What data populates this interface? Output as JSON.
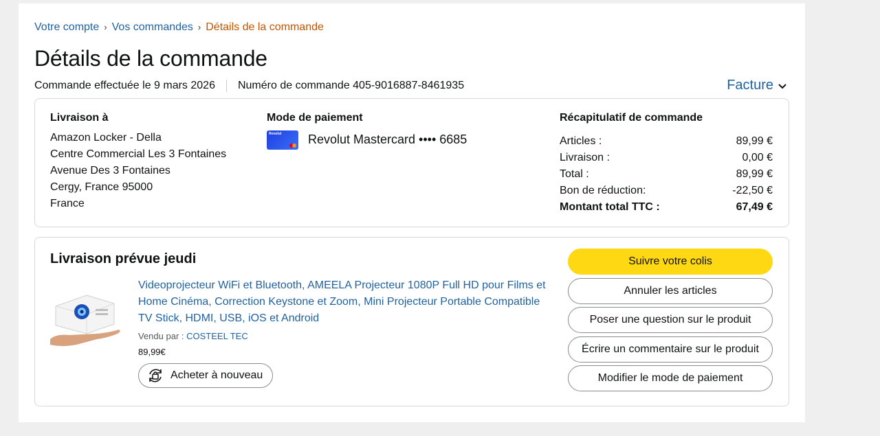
{
  "breadcrumb": {
    "item1": "Votre compte",
    "item2": "Vos commandes",
    "current": "Détails de la commande",
    "separator": "›"
  },
  "page_title": "Détails de la commande",
  "order_meta": {
    "placed": "Commande effectuée le 9 mars 2026",
    "number": "Numéro de commande 405-9016887-8461935"
  },
  "invoice_label": "Facture",
  "shipping": {
    "heading": "Livraison à",
    "lines": [
      "Amazon Locker - Della",
      "Centre Commercial Les 3 Fontaines",
      "Avenue Des 3 Fontaines",
      "Cergy, France 95000",
      "France"
    ]
  },
  "payment": {
    "heading": "Mode de paiement",
    "card_brand": "Revolut",
    "card_text": "Revolut Mastercard •••• 6685"
  },
  "summary": {
    "heading": "Récapitulatif de commande",
    "rows": [
      {
        "label": "Articles :",
        "value": "89,99 €"
      },
      {
        "label": "Livraison :",
        "value": "0,00 €"
      },
      {
        "label": "Total :",
        "value": "89,99 €"
      },
      {
        "label": "Bon de réduction:",
        "value": "-22,50 €"
      },
      {
        "label": "Montant total TTC :",
        "value": "67,49 €"
      }
    ]
  },
  "delivery": {
    "title": "Livraison prévue jeudi",
    "product_title": "Videoprojecteur WiFi et Bluetooth, AMEELA Projecteur 1080P Full HD pour Films et Home Cinéma, Correction Keystone et Zoom, Mini Projecteur Portable Compatible TV Stick, HDMI, USB, iOS et Android",
    "seller_prefix": "Vendu par  : ",
    "seller_name": "COSTEEL TEC",
    "price": "89,99€",
    "buy_again": "Acheter à nouveau"
  },
  "actions": {
    "track": "Suivre votre colis",
    "cancel": "Annuler les articles",
    "question": "Poser une question sur le produit",
    "review": "Écrire un commentaire sur le produit",
    "change_payment": "Modifier le mode de paiement"
  },
  "colors": {
    "link": "#2162a1",
    "breadcrumb_current": "#c45500",
    "primary_button": "#ffd814"
  }
}
